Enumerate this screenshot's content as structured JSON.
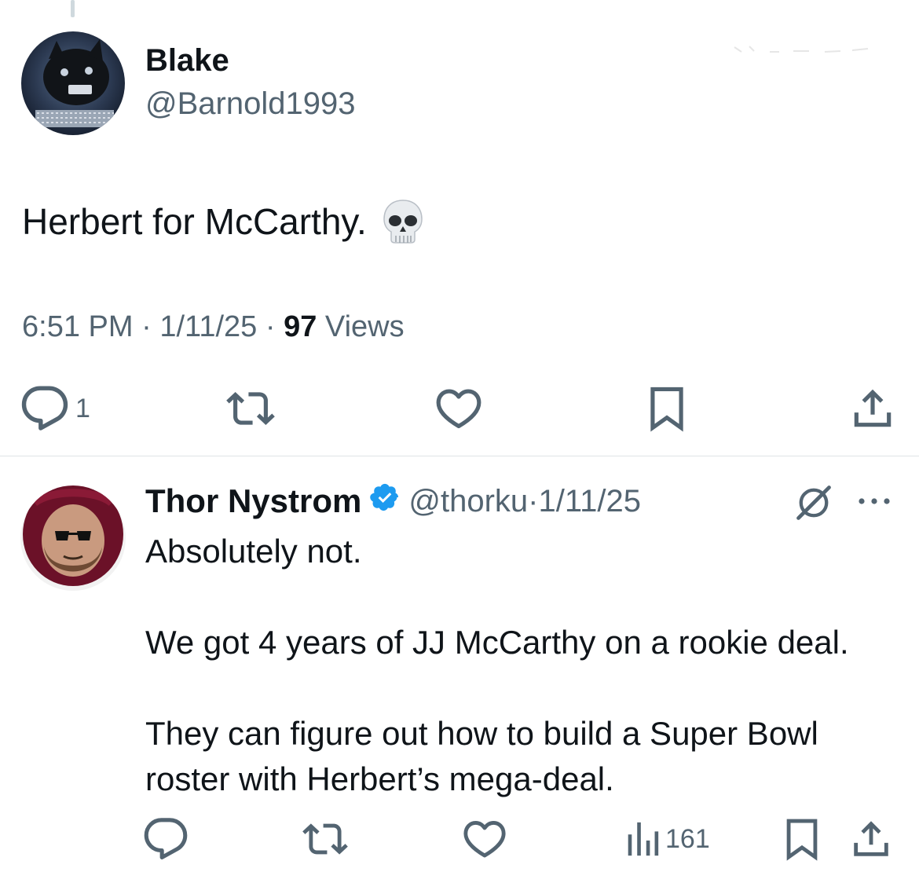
{
  "main_tweet": {
    "name": "Blake",
    "handle": "@Barnold1993",
    "text": "Herbert for McCarthy.",
    "emoji": "skull-emoji",
    "time": "6:51 PM",
    "date": "1/11/25",
    "separator": "·",
    "views_count": "97",
    "views_label": "Views",
    "actions": {
      "reply_count": "1"
    }
  },
  "reply_tweet": {
    "name": "Thor Nystrom",
    "verified": true,
    "handle": "@thorku",
    "separator": "·",
    "date": "1/11/25",
    "paragraphs": [
      "Absolutely not.",
      "We got 4 years of JJ McCarthy on a rookie deal.",
      "They can figure out how to build a Super Bowl roster with Herbert’s mega-deal."
    ],
    "actions": {
      "views_count": "161"
    }
  },
  "colors": {
    "text": "#0f1419",
    "secondary": "#536471",
    "verified": "#1d9bf0",
    "divider": "#dfe3e6"
  },
  "icons": [
    "reply-icon",
    "retweet-icon",
    "like-icon",
    "bookmark-icon",
    "share-icon",
    "verified-badge-icon",
    "grok-icon",
    "more-icon",
    "views-icon"
  ]
}
